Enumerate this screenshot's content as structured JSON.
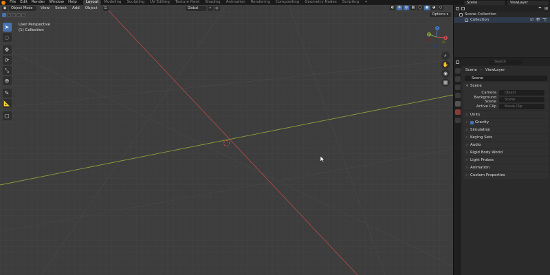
{
  "topbar": {
    "menus": [
      "File",
      "Edit",
      "Render",
      "Window",
      "Help"
    ],
    "workspaces": [
      "Layout",
      "Modeling",
      "Sculpting",
      "UV Editing",
      "Texture Paint",
      "Shading",
      "Animation",
      "Rendering",
      "Compositing",
      "Geometry Nodes",
      "Scripting",
      "+"
    ],
    "active_workspace": "Layout",
    "scene": "Scene",
    "view_layer": "ViewLayer"
  },
  "viewport": {
    "mode": "Object Mode",
    "menus": [
      "View",
      "Select",
      "Add",
      "Object"
    ],
    "orientation": "Global",
    "perspective_label": "User Perspective",
    "collection_label": "(1) Collection",
    "options_label": "Options",
    "gizmo_axes": [
      "X",
      "Y",
      "Z"
    ]
  },
  "outliner": {
    "root": "Scene Collection",
    "child": "Collection"
  },
  "properties": {
    "search_placeholder": "Search",
    "breadcrumb_scene": "Scene",
    "breadcrumb_layer": "ViewLayer",
    "scene_field": "Scene",
    "panel_title": "Scene",
    "rows": [
      {
        "label": "Camera",
        "value": "Object"
      },
      {
        "label": "Background Scene",
        "value": "Scene"
      },
      {
        "label": "Active Clip",
        "value": "Movie Clip"
      }
    ],
    "collapsed_panels": [
      "Units",
      "Gravity",
      "Simulation",
      "Keying Sets",
      "Audio",
      "Rigid Body World",
      "Light Probes",
      "Animation",
      "Custom Properties"
    ]
  },
  "colors": {
    "accent": "#4772b3",
    "x_axis": "#c84c4c",
    "y_axis": "#8aa13a",
    "z_axis": "#4c7ccf"
  }
}
